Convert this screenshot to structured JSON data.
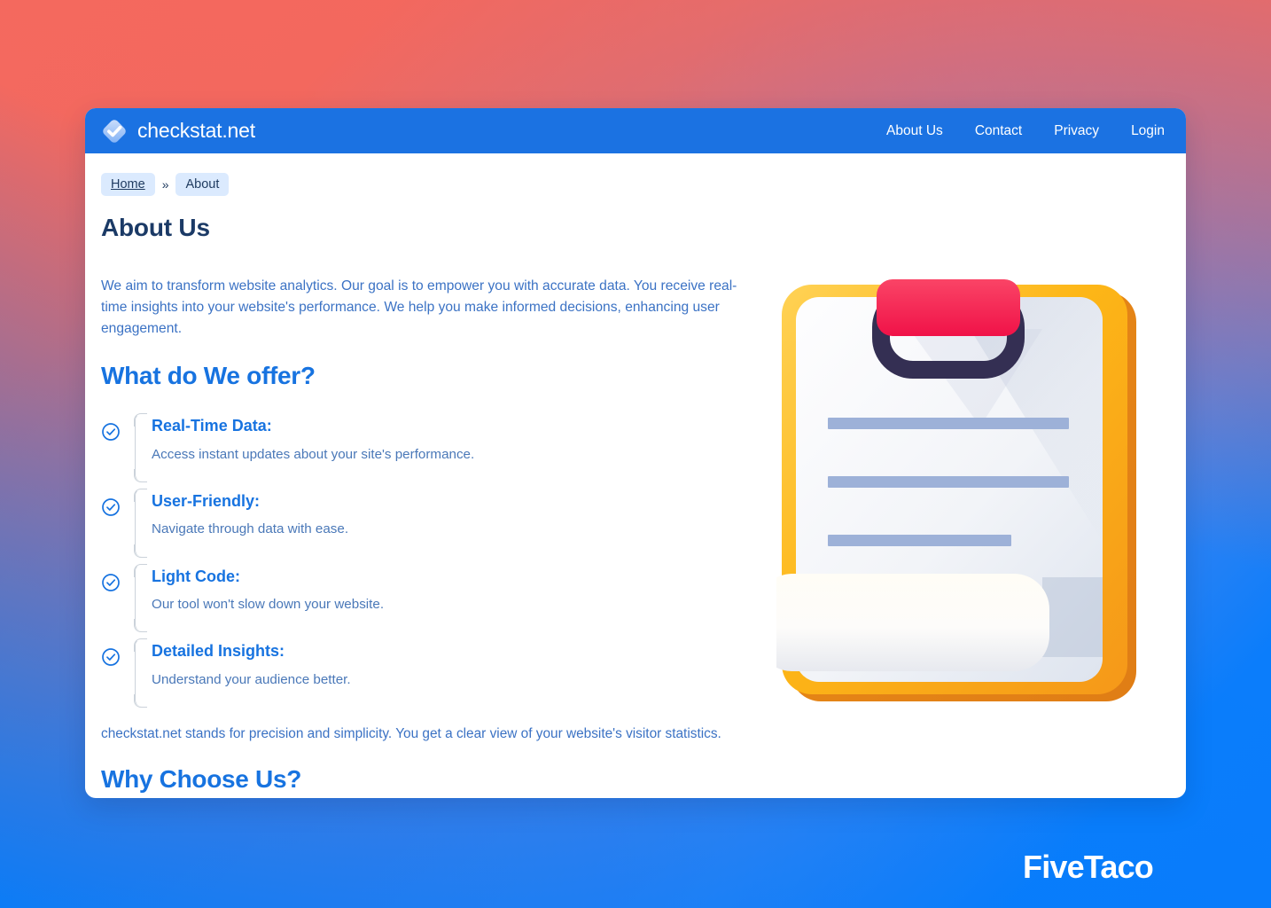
{
  "background": {
    "gradient_from": "#f4695f",
    "gradient_mid": "#6a7fd6",
    "gradient_to": "#0b7cfb"
  },
  "header": {
    "brand_name": "checkstat.net",
    "brand_icon": "check-diamond-logo-icon",
    "background_color": "#1b72e2",
    "nav": [
      {
        "label": "About Us"
      },
      {
        "label": "Contact"
      },
      {
        "label": "Privacy"
      },
      {
        "label": "Login"
      }
    ]
  },
  "breadcrumb": {
    "home_label": "Home",
    "separator": "»",
    "current_label": "About"
  },
  "page": {
    "title": "About Us",
    "intro": "We aim to transform website analytics. Our goal is to empower you with accurate data. You receive real-time insights into your website's performance. We help you make informed decisions, enhancing user engagement.",
    "offer_heading": "What do We offer?",
    "closing": "checkstat.net stands for precision and simplicity. You get a clear view of your website's visitor statistics.",
    "why_heading": "Why Choose Us?"
  },
  "features": [
    {
      "icon": "check-circle-icon",
      "title": "Real-Time Data:",
      "desc": "Access instant updates about your site's performance."
    },
    {
      "icon": "check-circle-icon",
      "title": "User-Friendly:",
      "desc": "Navigate through data with ease."
    },
    {
      "icon": "check-circle-icon",
      "title": "Light Code:",
      "desc": "Our tool won't slow down your website."
    },
    {
      "icon": "check-circle-icon",
      "title": "Detailed Insights:",
      "desc": "Understand your audience better."
    }
  ],
  "illustration": {
    "name": "clipboard-document-illustration",
    "board_color": "#f9ab1a",
    "board_color_light": "#ffd04d",
    "paper_color": "#fbfbfd",
    "clip_top_color": "#f6294f",
    "clip_ring_color": "#342f53",
    "line_color": "#9db1d8"
  },
  "watermark": {
    "text": "FiveTaco"
  }
}
